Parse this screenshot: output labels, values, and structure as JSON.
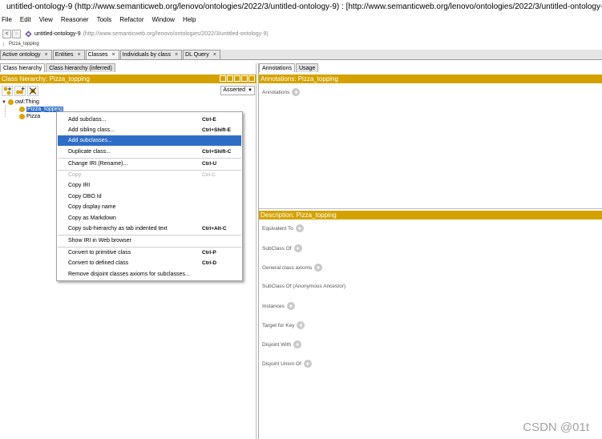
{
  "window": {
    "title": "untitled-ontology-9 (http://www.semanticweb.org/lenovo/ontologies/2022/3/untitled-ontology-9)  : [http://www.semanticweb.org/lenovo/ontologies/2022/3/untitled-ontology-9]"
  },
  "menubar": [
    "File",
    "Edit",
    "View",
    "Reasoner",
    "Tools",
    "Refactor",
    "Window",
    "Help"
  ],
  "address": {
    "back": "<",
    "forward": ">",
    "ontology_name": "untitled-ontology-9",
    "ontology_iri": "(http://www.semanticweb.org/lenovo/ontologies/2022/3/untitled-ontology-9)"
  },
  "breadcrumb": "Pizza_topping",
  "tabs": [
    {
      "label": "Active ontology",
      "close": "×"
    },
    {
      "label": "Entities",
      "close": "×"
    },
    {
      "label": "Classes",
      "close": "×"
    },
    {
      "label": "Individuals by class",
      "close": "×"
    },
    {
      "label": "DL Query",
      "close": "×"
    }
  ],
  "left": {
    "subtabs": [
      "Class hierarchy",
      "Class hierarchy (inferred)"
    ],
    "header": "Class hierarchy: Pizza_topping",
    "asserted": "Asserted",
    "tree": [
      {
        "label": "owl:Thing"
      },
      {
        "label": "Pizza_topping"
      },
      {
        "label": "Pizza"
      }
    ]
  },
  "context_menu": [
    {
      "label": "Add subclass...",
      "shortcut": "Ctrl-E"
    },
    {
      "label": "Add sibling class...",
      "shortcut": "Ctrl+Shift-E"
    },
    {
      "label": "Add subclasses...",
      "shortcut": ""
    },
    {
      "label": "Duplicate class...",
      "shortcut": "Ctrl+Shift-C"
    },
    {
      "label": "Change IRI (Rename)...",
      "shortcut": "Ctrl-U"
    },
    {
      "label": "Copy",
      "shortcut": "Ctrl-C"
    },
    {
      "label": "Copy IRI",
      "shortcut": ""
    },
    {
      "label": "Copy OBO Id",
      "shortcut": ""
    },
    {
      "label": "Copy display name",
      "shortcut": ""
    },
    {
      "label": "Copy as Markdown",
      "shortcut": ""
    },
    {
      "label": "Copy sub-hierarchy as tab indented text",
      "shortcut": "Ctrl+Alt-C"
    },
    {
      "label": "Show IRI in Web browser",
      "shortcut": ""
    },
    {
      "label": "Convert to primitive class",
      "shortcut": "Ctrl-P"
    },
    {
      "label": "Convert to defined class",
      "shortcut": "Ctrl-D"
    },
    {
      "label": "Remove disjoint classes axioms for subclasses...",
      "shortcut": ""
    }
  ],
  "right": {
    "subtabs": [
      "Annotations",
      "Usage"
    ],
    "annotations_header": "Annotations: Pizza_topping",
    "annotations_label": "Annotations",
    "description_header": "Description: Pizza_topping",
    "description_rows": [
      "Equivalent To",
      "SubClass Of",
      "General class axioms",
      "SubClass Of (Anonymous Ancestor)",
      "Instances",
      "Target for Key",
      "Disjoint With",
      "Disjoint Union Of"
    ]
  },
  "watermark": "CSDN @01t",
  "colors": {
    "header_bar": "#d4a200",
    "selection": "#2f6ec6",
    "class_dot": "#d9a400"
  }
}
